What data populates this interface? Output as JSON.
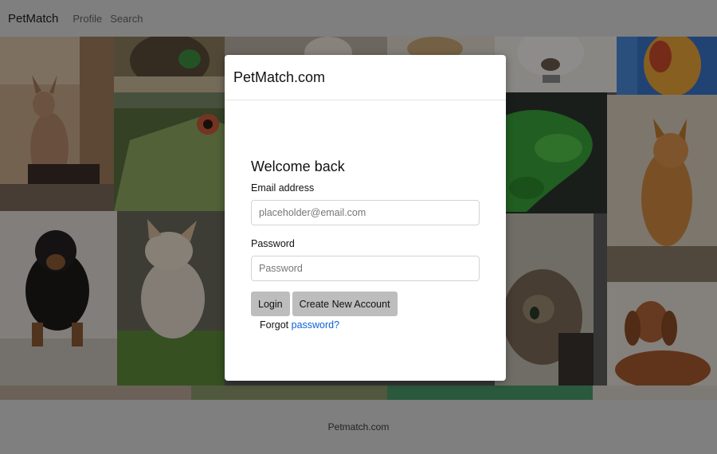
{
  "navbar": {
    "brand": "PetMatch",
    "links": [
      "Profile",
      "Search"
    ]
  },
  "collage": {
    "tiles": [
      {
        "name": "sphynx-cat-photo",
        "bg": "#caa88a"
      },
      {
        "name": "hedgehog-photo",
        "bg": "#8a7a5a"
      },
      {
        "name": "pet-photo-top",
        "bg": "#c9c2b8"
      },
      {
        "name": "pet-photo-top-2",
        "bg": "#e0dcd4"
      },
      {
        "name": "white-dog-photo",
        "bg": "#ebe7e2"
      },
      {
        "name": "colorful-bird-photo",
        "bg": "#d08a4a"
      },
      {
        "name": "iguana-photo",
        "bg": "#6e8a4a"
      },
      {
        "name": "green-snake-photo",
        "bg": "#2a3a2a"
      },
      {
        "name": "orange-cat-photo",
        "bg": "#d8c6b0"
      },
      {
        "name": "dachshund-puppy-photo",
        "bg": "#d6d2cc"
      },
      {
        "name": "white-cat-grass-photo",
        "bg": "#7b8a5a"
      },
      {
        "name": "tabby-cat-photo",
        "bg": "#a89e8e"
      },
      {
        "name": "dachshund-dog-photo",
        "bg": "#d8cfc8"
      }
    ]
  },
  "modal": {
    "title": "PetMatch.com",
    "heading": "Welcome back",
    "email_label": "Email address",
    "email_placeholder": "placeholder@email.com",
    "password_label": "Password",
    "password_placeholder": "Password",
    "login_label": "Login",
    "create_label": "Create New Account",
    "forgot_prefix": "Forgot",
    "forgot_link": "password?"
  },
  "footer": {
    "text": "Petmatch.com"
  }
}
